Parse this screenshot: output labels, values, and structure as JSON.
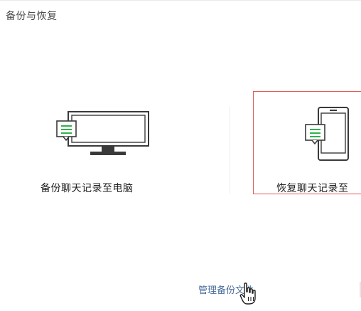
{
  "window": {
    "title": "备份与恢复"
  },
  "options": {
    "backup": {
      "label": "备份聊天记录至电脑",
      "icon": "monitor-chat-icon"
    },
    "restore": {
      "label": "恢复聊天记录至",
      "icon": "phone-chat-icon"
    }
  },
  "footer": {
    "manage_link": "管理备份文件"
  },
  "colors": {
    "selected_border": "#e05a5a",
    "chat_bubble": "#2fb34a",
    "link": "#4a6d9b"
  }
}
